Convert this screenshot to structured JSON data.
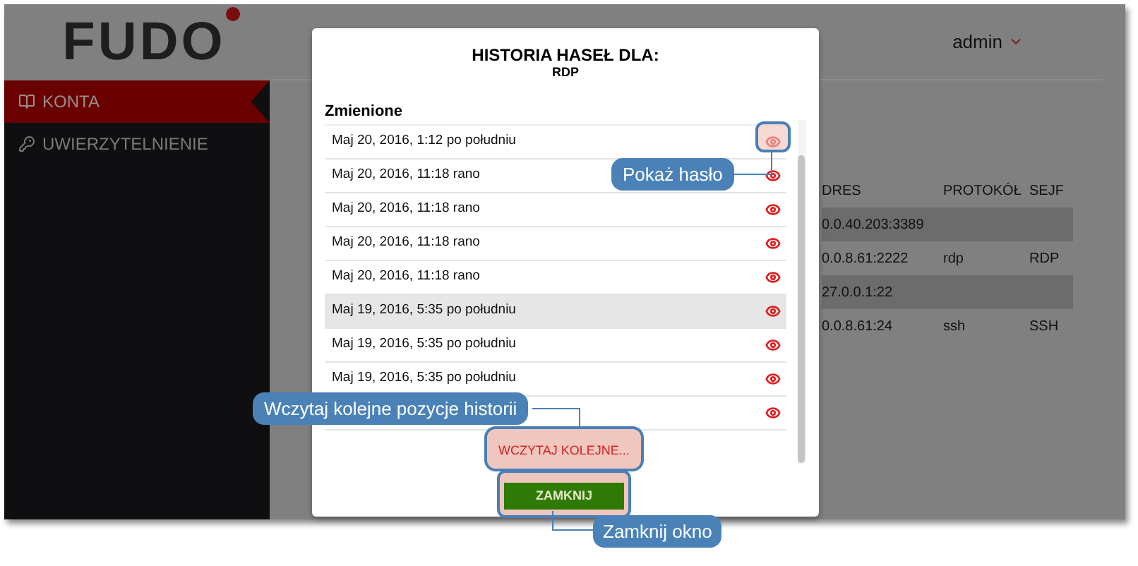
{
  "header": {
    "logo": "FUDO",
    "user": "admin"
  },
  "sidebar": {
    "items": [
      {
        "label": "KONTA",
        "selected": true
      },
      {
        "label": "UWIERZYTELNIENIE",
        "selected": false
      }
    ]
  },
  "table": {
    "columns": [
      "DRES",
      "PROTOKÓŁ",
      "SEJF"
    ],
    "rows": [
      {
        "kind": "group",
        "cells": [
          "0.0.40.203:3389"
        ]
      },
      {
        "kind": "item",
        "cells": [
          "0.0.8.61:2222",
          "rdp",
          "RDP"
        ]
      },
      {
        "kind": "group",
        "cells": [
          "27.0.0.1:22"
        ]
      },
      {
        "kind": "item",
        "cells": [
          "0.0.8.61:24",
          "ssh",
          "SSH"
        ]
      }
    ]
  },
  "dialog": {
    "title": "HISTORIA HASEŁ DLA:",
    "subtitle": "RDP",
    "section": "Zmienione",
    "entries": [
      {
        "date": "Maj 20, 2016, 1:12 po południu",
        "highlighted": false
      },
      {
        "date": "Maj 20, 2016, 11:18 rano",
        "highlighted": false
      },
      {
        "date": "Maj 20, 2016, 11:18 rano",
        "highlighted": false
      },
      {
        "date": "Maj 20, 2016, 11:18 rano",
        "highlighted": false
      },
      {
        "date": "Maj 20, 2016, 11:18 rano",
        "highlighted": false
      },
      {
        "date": "Maj 19, 2016, 5:35 po południu",
        "highlighted": true
      },
      {
        "date": "Maj 19, 2016, 5:35 po południu",
        "highlighted": false
      },
      {
        "date": "Maj 19, 2016, 5:35 po południu",
        "highlighted": false
      },
      {
        "highlighted": false
      }
    ],
    "load_more": "WCZYTAJ KOLEJNE...",
    "close": "ZAMKNIJ"
  },
  "callouts": [
    "Pokaż hasło",
    "Wczytaj kolejne pozycje historii",
    "Zamknij okno"
  ]
}
